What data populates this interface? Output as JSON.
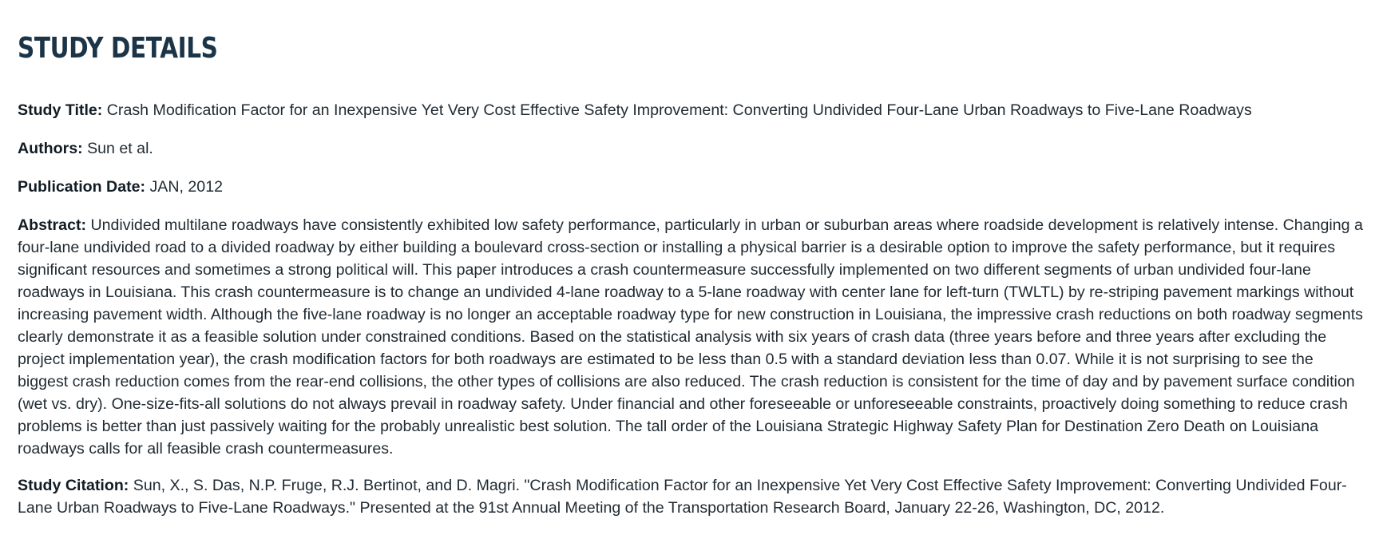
{
  "page": {
    "title": "STUDY DETAILS"
  },
  "details": {
    "study_title": {
      "label": "Study Title:",
      "value": "Crash Modification Factor for an Inexpensive Yet Very Cost Effective Safety Improvement: Converting Undivided Four-Lane Urban Roadways to Five-Lane Roadways"
    },
    "authors": {
      "label": "Authors:",
      "value": "Sun et al."
    },
    "publication_date": {
      "label": "Publication Date:",
      "value": "JAN, 2012"
    },
    "abstract": {
      "label": "Abstract:",
      "value": "Undivided multilane roadways have consistently exhibited low safety performance, particularly in urban or suburban areas where roadside development is relatively intense. Changing a four-lane undivided road to a divided roadway by either building a boulevard cross-section or installing a physical barrier is a desirable option to improve the safety performance, but it requires significant resources and sometimes a strong political will. This paper introduces a crash countermeasure successfully implemented on two different segments of urban undivided four-lane roadways in Louisiana. This crash countermeasure is to change an undivided 4-lane roadway to a 5-lane roadway with center lane for left-turn (TWLTL) by re-striping pavement markings without increasing pavement width. Although the five-lane roadway is no longer an acceptable roadway type for new construction in Louisiana, the impressive crash reductions on both roadway segments clearly demonstrate it as a feasible solution under constrained conditions. Based on the statistical analysis with six years of crash data (three years before and three years after excluding the project implementation year), the crash modification factors for both roadways are estimated to be less than 0.5 with a standard deviation less than 0.07. While it is not surprising to see the biggest crash reduction comes from the rear-end collisions, the other types of collisions are also reduced. The crash reduction is consistent for the time of day and by pavement surface condition (wet vs. dry). One-size-fits-all solutions do not always prevail in roadway safety. Under financial and other foreseeable or unforeseeable constraints, proactively doing something to reduce crash problems is better than just passively waiting for the probably unrealistic best solution. The tall order of the Louisiana Strategic Highway Safety Plan for Destination Zero Death on Louisiana roadways calls for all feasible crash countermeasures."
    },
    "citation": {
      "label": "Study Citation:",
      "value": "Sun, X., S. Das, N.P. Fruge, R.J. Bertinot, and D. Magri. \"Crash Modification Factor for an Inexpensive Yet Very Cost Effective Safety Improvement: Converting Undivided Four-Lane Urban Roadways to Five-Lane Roadways.\" Presented at the 91st Annual Meeting of the Transportation Research Board, January 22-26, Washington, DC, 2012."
    }
  }
}
